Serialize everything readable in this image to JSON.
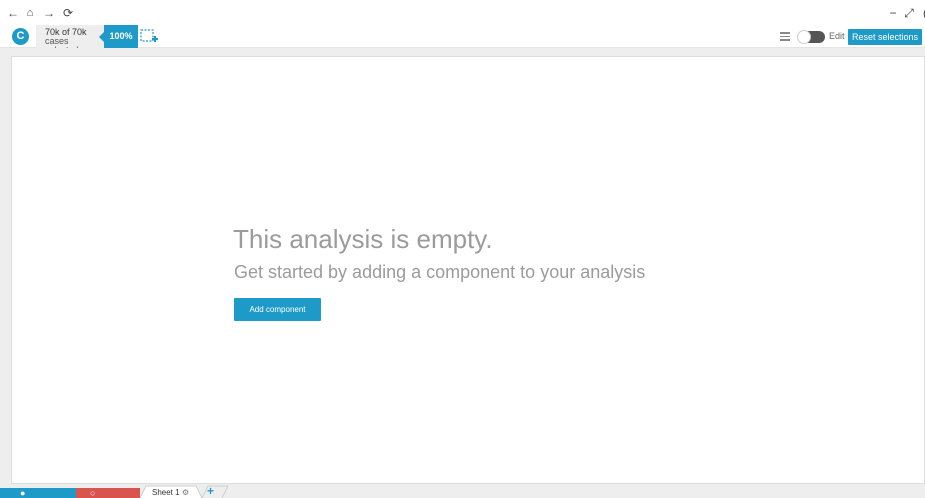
{
  "nav": {
    "back": "←",
    "home": "⌂",
    "forward": "→",
    "reload": "⟳",
    "minimize": "−",
    "expand": "⤢",
    "close": "("
  },
  "toolbar": {
    "logo_letter": "C",
    "selection_line1": "70k of 70k",
    "selection_line2": "cases selected",
    "percent": "100%",
    "edit_label": "Edit",
    "reset_label": "Reset selections"
  },
  "main": {
    "empty_title": "This analysis is empty.",
    "empty_subtitle": "Get started by adding a component to your analysis",
    "add_button_label": "Add component"
  },
  "bottom": {
    "sheet_label": "Sheet 1",
    "gear": "⚙",
    "add_sheet": "+",
    "blue_icon": "●",
    "red_icon": "○"
  },
  "colors": {
    "accent": "#1e9ac9",
    "danger": "#d9534f",
    "empty_text": "#9b9b9b"
  }
}
